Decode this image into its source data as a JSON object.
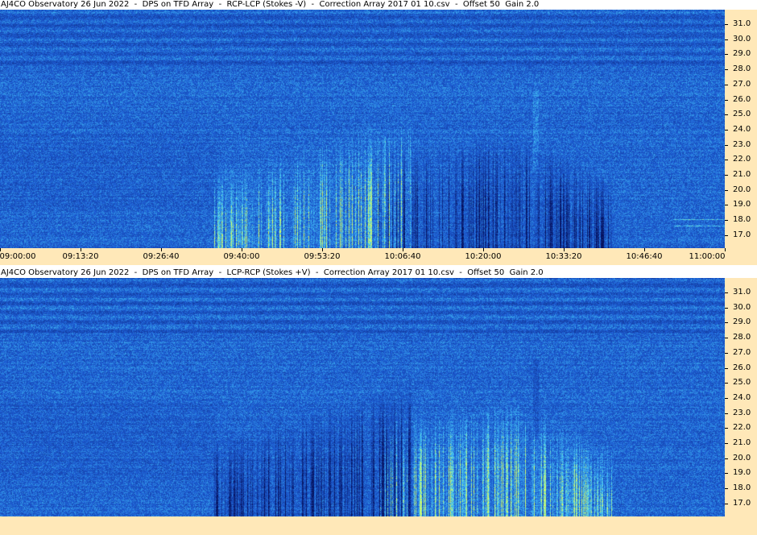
{
  "panels": [
    {
      "title": "AJ4CO Observatory 26 Jun 2022  -  DPS on TFD Array  -  RCP-LCP (Stokes -V)  -  Correction Array 2017 01 10.csv  -  Offset 50  Gain 2.0",
      "polarity": "positive-burst"
    },
    {
      "title": "AJ4CO Observatory 26 Jun 2022  -  DPS on TFD Array  -  LCP-RCP (Stokes +V)  -  Correction Array 2017 01 10.csv  -  Offset 50  Gain 2.0",
      "polarity": "negative-burst"
    }
  ],
  "freq_ticks": [
    "31.0",
    "30.0",
    "29.0",
    "28.0",
    "27.0",
    "26.0",
    "25.0",
    "24.0",
    "23.0",
    "22.0",
    "21.0",
    "20.0",
    "19.0",
    "18.0",
    "17.0"
  ],
  "time_ticks": [
    "09:00:00",
    "09:13:20",
    "09:26:40",
    "09:40:00",
    "09:53:20",
    "10:06:40",
    "10:20:00",
    "10:33:20",
    "10:46:40",
    "11:00:00"
  ],
  "colors": {
    "background_blue": "#1e5fd6",
    "deep_blue": "#0a1e7a",
    "cyan": "#60e0ff",
    "yellow_green": "#d8ff60",
    "axis_panel": "#ffe8b8"
  }
}
